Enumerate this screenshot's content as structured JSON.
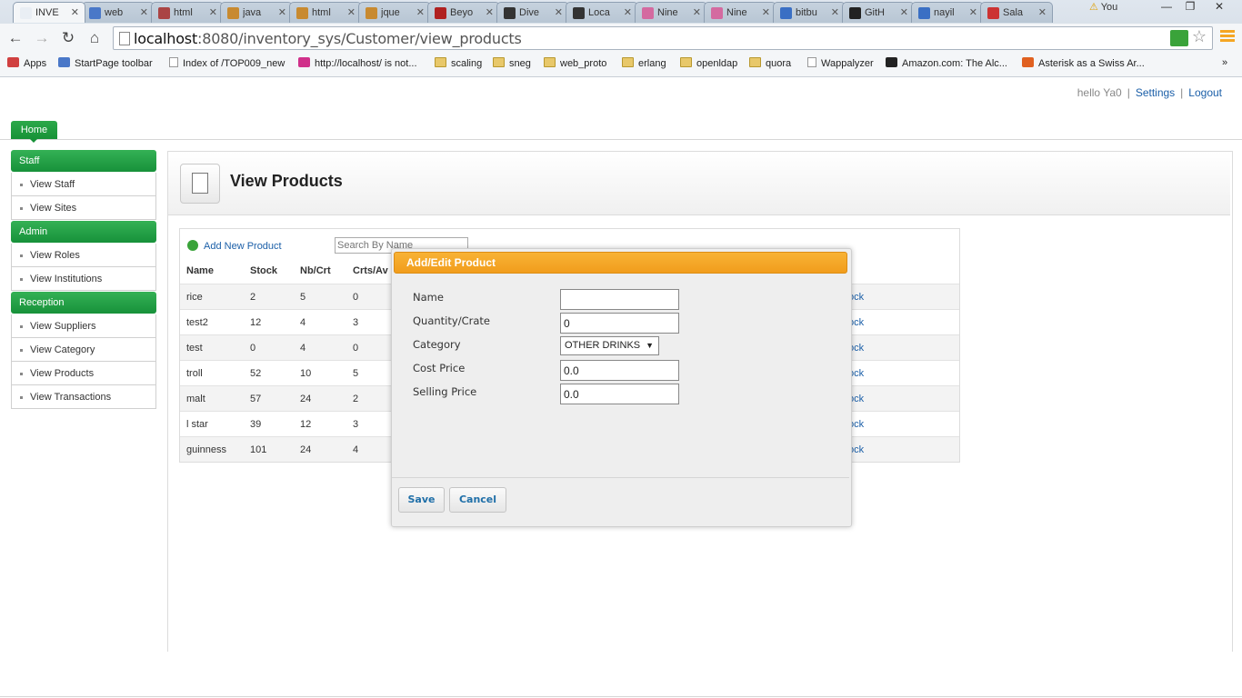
{
  "browser": {
    "tabs": [
      {
        "label": "INVE",
        "icon_color": "#e9eef4",
        "active": true
      },
      {
        "label": "web",
        "icon_color": "#4a78c8"
      },
      {
        "label": "html",
        "icon_color": "#aa4444"
      },
      {
        "label": "java",
        "icon_color": "#c88a30"
      },
      {
        "label": "html",
        "icon_color": "#c88a30"
      },
      {
        "label": "jque",
        "icon_color": "#c88a30"
      },
      {
        "label": "Beyo",
        "icon_color": "#b02020"
      },
      {
        "label": "Dive",
        "icon_color": "#333333"
      },
      {
        "label": "Loca",
        "icon_color": "#333333"
      },
      {
        "label": "Nine",
        "icon_color": "#d46aa0"
      },
      {
        "label": "Nine",
        "icon_color": "#d46aa0"
      },
      {
        "label": "bitbu",
        "icon_color": "#3a6fc4"
      },
      {
        "label": "GitH",
        "icon_color": "#222222"
      },
      {
        "label": "nayil",
        "icon_color": "#3a6fc4"
      },
      {
        "label": "Sala",
        "icon_color": "#cc3333"
      }
    ],
    "user_chip": "You",
    "window_buttons": {
      "minimize": "—",
      "restore": "❐",
      "close": "✕"
    },
    "nav": {
      "back": "←",
      "forward": "→",
      "reload": "↻",
      "home": "⌂"
    },
    "url_host": "localhost",
    "url_rest": ":8080/inventory_sys/Customer/view_products",
    "star_icon": "☆",
    "bookmarks": [
      {
        "label": "Apps",
        "icon": "apps-icon"
      },
      {
        "label": "StartPage toolbar",
        "icon": "startpage-icon"
      },
      {
        "label": "Index of /TOP009_new",
        "icon": "page-icon"
      },
      {
        "label": "http://localhost/ is not...",
        "icon": "localhost-icon"
      },
      {
        "label": "scaling",
        "icon": "folder-icon"
      },
      {
        "label": "sneg",
        "icon": "folder-icon"
      },
      {
        "label": "web_proto",
        "icon": "folder-icon"
      },
      {
        "label": "erlang",
        "icon": "folder-icon"
      },
      {
        "label": "openldap",
        "icon": "folder-icon"
      },
      {
        "label": "quora",
        "icon": "folder-icon"
      },
      {
        "label": "Wappalyzer",
        "icon": "page-icon"
      },
      {
        "label": "Amazon.com: The Alc...",
        "icon": "amazon-icon"
      },
      {
        "label": "Asterisk as a Swiss Ar...",
        "icon": "asterisk-icon"
      }
    ],
    "bookmarks_overflow": "»"
  },
  "header": {
    "greeting": "hello Ya0",
    "settings": "Settings",
    "logout": "Logout",
    "separator": "|",
    "home_tab": "Home"
  },
  "sidebar": {
    "sections": [
      {
        "title": "Staff",
        "items": [
          "View Staff",
          "View Sites"
        ]
      },
      {
        "title": "Admin",
        "items": [
          "View Roles",
          "View Institutions"
        ]
      },
      {
        "title": "Reception",
        "items": [
          "View Suppliers",
          "View Category",
          "View Products",
          "View Transactions"
        ]
      }
    ]
  },
  "page": {
    "title": "View Products",
    "add_link": "Add New Product",
    "search_placeholder": "Search By Name"
  },
  "table": {
    "columns": [
      "Name",
      "Stock",
      "Nb/Crt",
      "Crts/Av"
    ],
    "rows": [
      {
        "name": "rice",
        "stock": "2",
        "nb": "5",
        "crts": "0",
        "action": "ock"
      },
      {
        "name": "test2",
        "stock": "12",
        "nb": "4",
        "crts": "3",
        "action": "ock"
      },
      {
        "name": "test",
        "stock": "0",
        "nb": "4",
        "crts": "0",
        "action": "ock"
      },
      {
        "name": "troll",
        "stock": "52",
        "nb": "10",
        "crts": "5",
        "action": "ock"
      },
      {
        "name": "malt",
        "stock": "57",
        "nb": "24",
        "crts": "2",
        "action": "ock"
      },
      {
        "name": "l star",
        "stock": "39",
        "nb": "12",
        "crts": "3",
        "action": "ock"
      },
      {
        "name": "guinness",
        "stock": "101",
        "nb": "24",
        "crts": "4",
        "action": "ock"
      }
    ]
  },
  "modal": {
    "title": "Add/Edit Product",
    "fields": {
      "name_label": "Name",
      "name_value": "",
      "qty_label": "Quantity/Crate",
      "qty_value": "0",
      "category_label": "Category",
      "category_value": "OTHER DRINKS",
      "cost_label": "Cost Price",
      "cost_value": "0.0",
      "selling_label": "Selling Price",
      "selling_value": "0.0"
    },
    "save": "Save",
    "cancel": "Cancel"
  },
  "colors": {
    "green_accent": "#17913a",
    "orange_modal": "#f19d1c",
    "link_blue": "#1b5fa8"
  }
}
